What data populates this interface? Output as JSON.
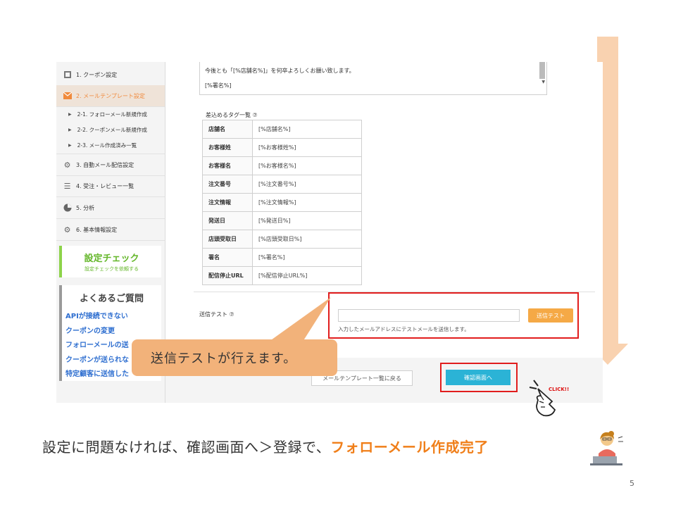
{
  "sidebar": {
    "items": [
      {
        "label": "1. クーポン設定",
        "icon": "coupon-icon"
      },
      {
        "label": "2. メールテンプレート設定",
        "icon": "mail-icon"
      },
      {
        "label": "3. 自動メール配信設定",
        "icon": "gears-icon"
      },
      {
        "label": "4. 受注・レビュー一覧",
        "icon": "list-icon"
      },
      {
        "label": "5. 分析",
        "icon": "pie-chart-icon"
      },
      {
        "label": "6. 基本情報設定",
        "icon": "gear-icon"
      }
    ],
    "subitems": [
      {
        "label": "2-1. フォローメール新規作成"
      },
      {
        "label": "2-2. クーポンメール新規作成"
      },
      {
        "label": "2-3. メール作成済み一覧"
      }
    ],
    "check": {
      "title": "設定チェック",
      "subtitle": "設定チェックを依頼する"
    },
    "faq": {
      "title": "よくあるご質問",
      "links": [
        "APIが接続できない",
        "クーポンの変更",
        "フォローメールの送",
        "クーポンが送られな",
        "特定顧客に送信した"
      ]
    }
  },
  "main": {
    "textarea": {
      "line1": "今後とも「[%店舗名%]」を何卒よろしくお願い致します。",
      "line2": "[%署名%]"
    },
    "tags": {
      "heading": "差込めるタグ一覧 ⑦",
      "rows": [
        {
          "name": "店舗名",
          "tag": "[%店舗名%]"
        },
        {
          "name": "お客様姓",
          "tag": "[%お客様姓%]"
        },
        {
          "name": "お客様名",
          "tag": "[%お客様名%]"
        },
        {
          "name": "注文番号",
          "tag": "[%注文番号%]"
        },
        {
          "name": "注文情報",
          "tag": "[%注文情報%]"
        },
        {
          "name": "発送日",
          "tag": "[%発送日%]"
        },
        {
          "name": "店頭受取日",
          "tag": "[%店頭受取日%]"
        },
        {
          "name": "署名",
          "tag": "[%署名%]"
        },
        {
          "name": "配信停止URL",
          "tag": "[%配信停止URL%]"
        }
      ]
    },
    "send_test": {
      "label": "送信テスト ⑦",
      "input_value": "",
      "button": "送信テスト",
      "helper": "入力したメールアドレスにテストメールを送信します。"
    },
    "footer": {
      "back_button": "メールテンプレート一覧に戻る",
      "confirm_button": "確認画面へ"
    }
  },
  "annotations": {
    "callout": "送信テストが行えます。",
    "click_label": "CLICK!!",
    "caption_plain": "設定に問題なければ、確認画面へ＞登録で、",
    "caption_highlight": "フォローメール作成完了",
    "slide_number": "5"
  },
  "colors": {
    "accent_orange": "#f08a3c",
    "red_highlight": "#e11d1d",
    "confirm_blue": "#2bb3d6",
    "check_green": "#65b72b",
    "arrow_peach": "#f9c9a0"
  }
}
